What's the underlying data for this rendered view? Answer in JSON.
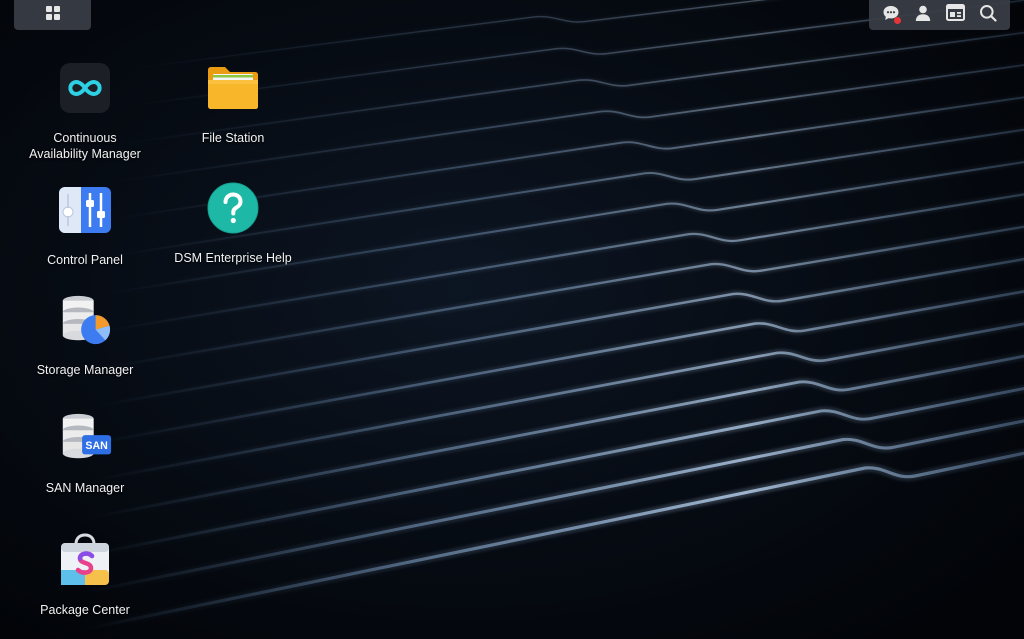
{
  "taskbar": {
    "main_menu_icon": "main-menu-icon",
    "tray": [
      {
        "name": "chat",
        "icon": "chat-bubble-icon",
        "has_notification": true
      },
      {
        "name": "user",
        "icon": "user-icon"
      },
      {
        "name": "widgets",
        "icon": "widgets-icon"
      },
      {
        "name": "search",
        "icon": "search-icon"
      }
    ]
  },
  "desktop": {
    "apps": [
      {
        "id": "cam",
        "label": "Continuous\nAvailability Manager",
        "icon": "infinity-icon"
      },
      {
        "id": "filestation",
        "label": "File Station",
        "icon": "folder-icon"
      },
      {
        "id": "controlpanel",
        "label": "Control Panel",
        "icon": "sliders-icon"
      },
      {
        "id": "help",
        "label": "DSM Enterprise Help",
        "icon": "question-icon"
      },
      {
        "id": "storage",
        "label": "Storage Manager",
        "icon": "database-pie-icon"
      },
      {
        "id": "san",
        "label": "SAN Manager",
        "icon": "database-san-icon",
        "badge": "SAN"
      },
      {
        "id": "package",
        "label": "Package Center",
        "icon": "shopping-bag-icon",
        "glyph": "S"
      }
    ]
  },
  "colors": {
    "background": "#020408",
    "taskbar": "#3a3e46",
    "accent_teal": "#1db9a6",
    "folder": "#f8b62a",
    "control_panel": "#3d7bf0",
    "notification": "#e8353a"
  }
}
